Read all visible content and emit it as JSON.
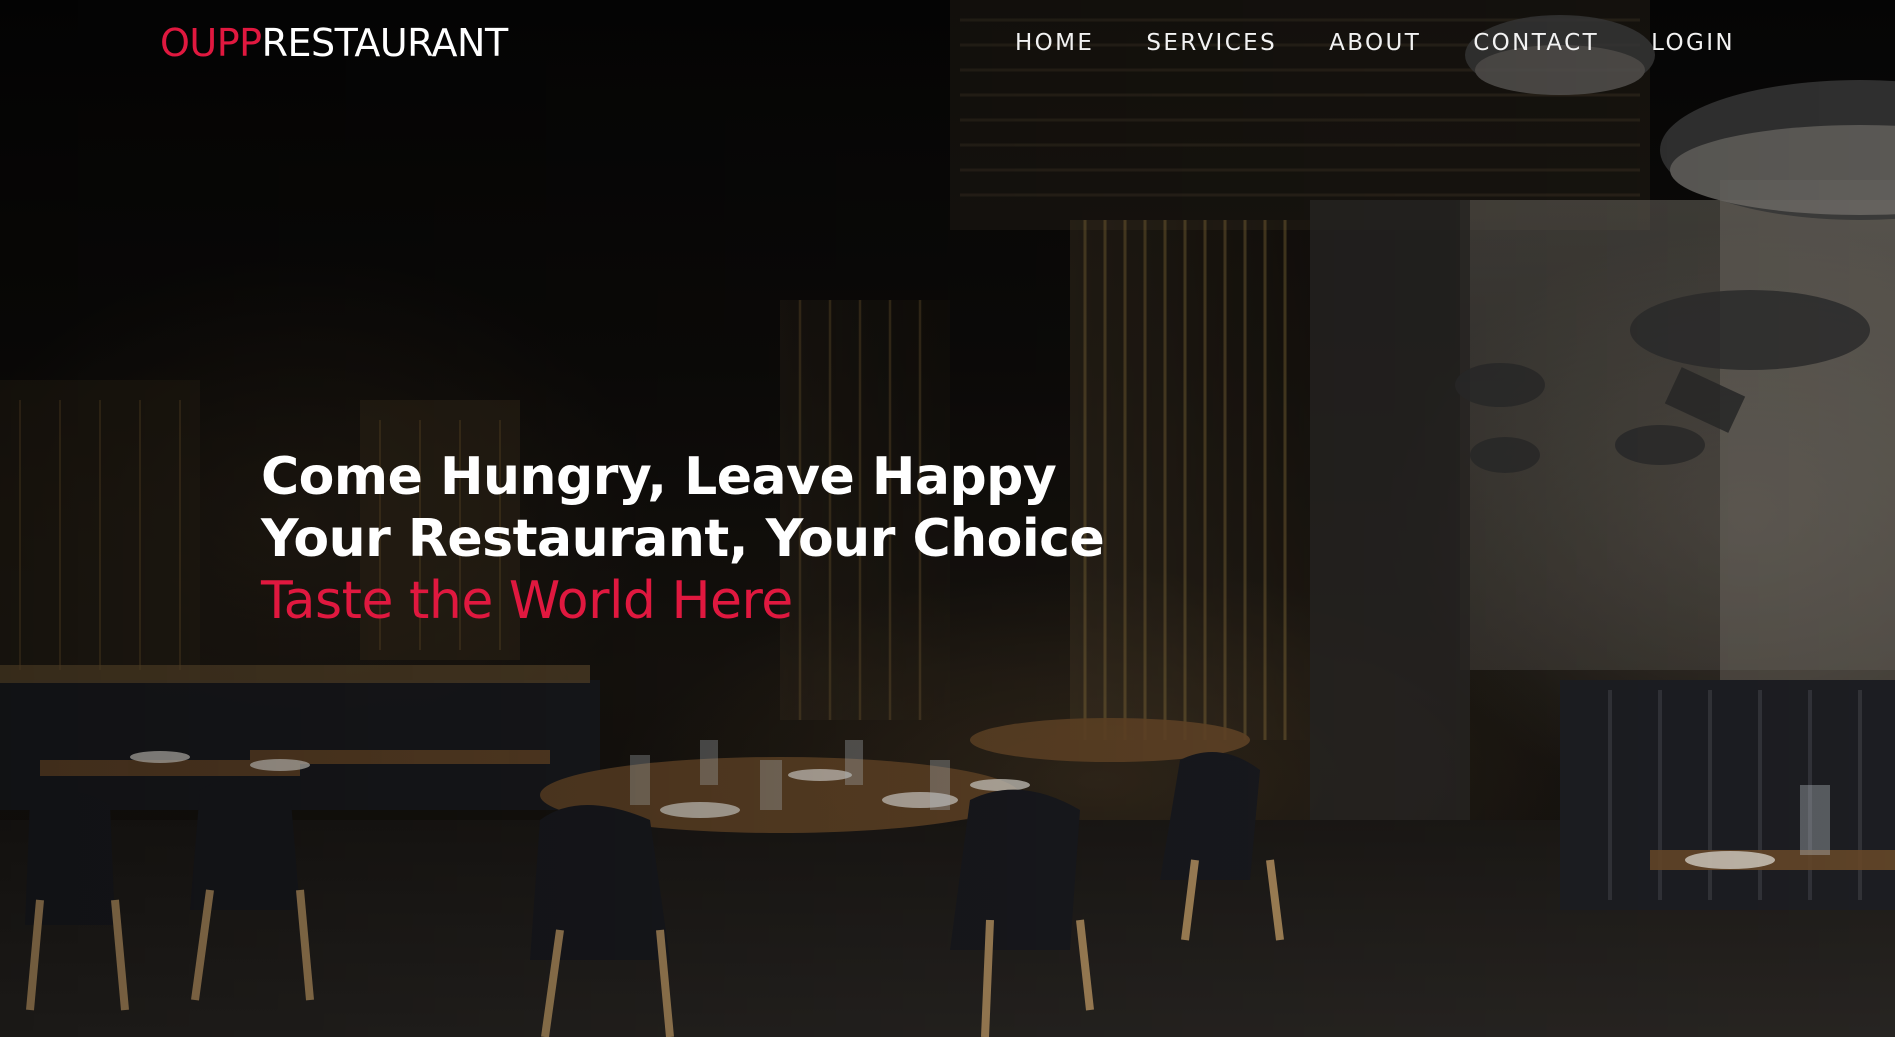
{
  "brand": {
    "accent": "OUPP",
    "rest": "RESTAURANT"
  },
  "nav": {
    "items": [
      {
        "label": "HOME"
      },
      {
        "label": "SERVICES"
      },
      {
        "label": "ABOUT"
      },
      {
        "label": "CONTACT"
      },
      {
        "label": "LOGIN"
      }
    ]
  },
  "hero": {
    "line1": "Come Hungry, Leave Happy",
    "line2": "Your Restaurant, Your Choice",
    "line3": "Taste the World Here"
  },
  "colors": {
    "accent": "#e0183f",
    "text": "#ffffff",
    "background": "#0b0a09"
  }
}
